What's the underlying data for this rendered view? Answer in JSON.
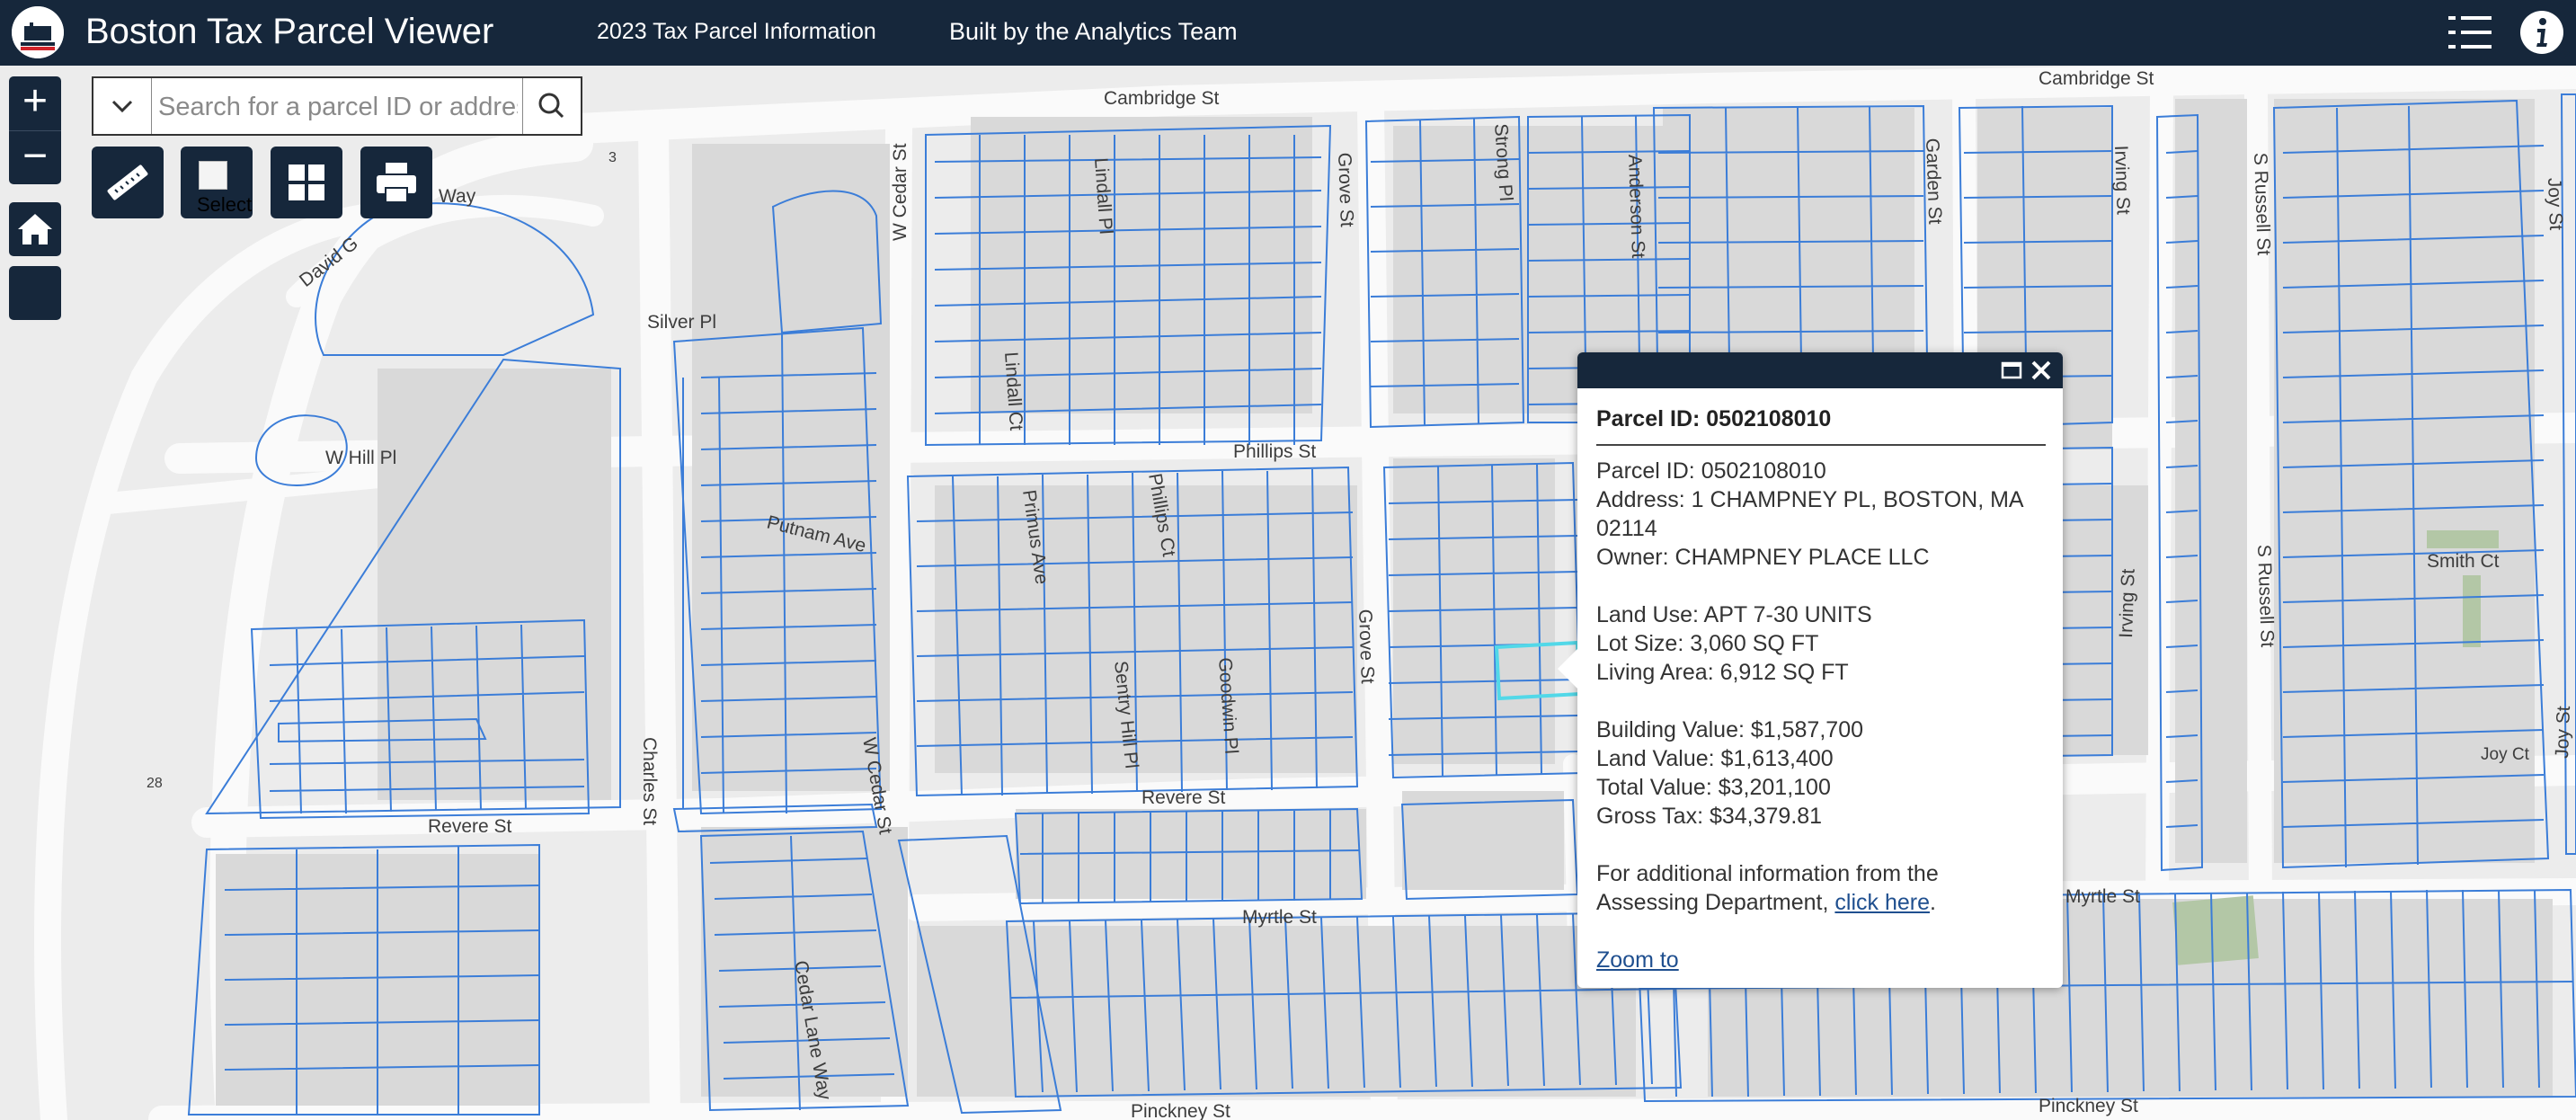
{
  "header": {
    "title": "Boston Tax Parcel Viewer",
    "link1": "2023 Tax Parcel Information",
    "link2": "Built by the Analytics Team"
  },
  "search": {
    "placeholder": "Search for a parcel ID or address",
    "value": ""
  },
  "tools": {
    "measure_icon": "ruler-icon",
    "select_label": "Select",
    "basemap_icon": "grid-icon",
    "print_icon": "printer-icon"
  },
  "controls": {
    "zoom_in": "+",
    "zoom_out": "−"
  },
  "streets": {
    "cambridge_1": "Cambridge St",
    "cambridge_2": "Cambridge St",
    "way": "Way",
    "david_g": "David G",
    "route3": "3",
    "route28": "28",
    "silver_pl": "Silver Pl",
    "w_hill_pl": "W Hill Pl",
    "putnam_ave": "Putnam Ave",
    "charles_st": "Charles St",
    "w_cedar_1": "W Cedar St",
    "w_cedar_2": "W Cedar St",
    "revere_1": "Revere St",
    "revere_2": "Revere St",
    "cedar_lane": "Cedar Lane Way",
    "lindall_pl": "Lindall Pl",
    "lindall_ct": "Lindall Ct",
    "phillips_st": "Phillips St",
    "primus_ave": "Primus Ave",
    "phillips_ct": "Phillips Ct",
    "sentry_hill": "Sentry Hill Pl",
    "goodwin_pl": "Goodwin Pl",
    "myrtle_1": "Myrtle St",
    "myrtle_2": "Myrtle St",
    "grove_1": "Grove St",
    "grove_2": "Grove St",
    "strong_pl": "Strong Pl",
    "anderson_st": "Anderson St",
    "garden_st": "Garden St",
    "irving_1": "Irving St",
    "irving_2": "Irving St",
    "s_russell_1": "S Russell St",
    "s_russell_2": "S Russell St",
    "joy_1": "Joy St",
    "joy_2": "Joy St",
    "smith_ct": "Smith Ct",
    "joy_ct": "Joy Ct",
    "pinckney_1": "Pinckney St",
    "pinckney_2": "Pinckney St"
  },
  "popup": {
    "title": "Parcel ID: 0502108010",
    "parcel_id": "Parcel ID: 0502108010",
    "address": "Address: 1 CHAMPNEY PL, BOSTON, MA 02114",
    "owner": "Owner: CHAMPNEY PLACE LLC",
    "land_use": "Land Use: APT 7-30 UNITS",
    "lot_size": "Lot Size: 3,060 SQ FT",
    "living_area": "Living Area: 6,912 SQ FT",
    "building_value": "Building Value: $1,587,700",
    "land_value": "Land Value: $1,613,400",
    "total_value": "Total Value: $3,201,100",
    "gross_tax": "Gross Tax: $34,379.81",
    "assessing_text": "For additional information from the Assessing Department, ",
    "click_here": "click here",
    "period": ".",
    "zoom_to": "Zoom to"
  },
  "colors": {
    "header_bg": "#16273b",
    "parcel_outline": "#3b7dd8",
    "selected_parcel": "#52d8e8",
    "map_bg": "#ececec",
    "road": "#fafafa",
    "building": "#d9d9d9",
    "park": "#b3c7a6"
  }
}
